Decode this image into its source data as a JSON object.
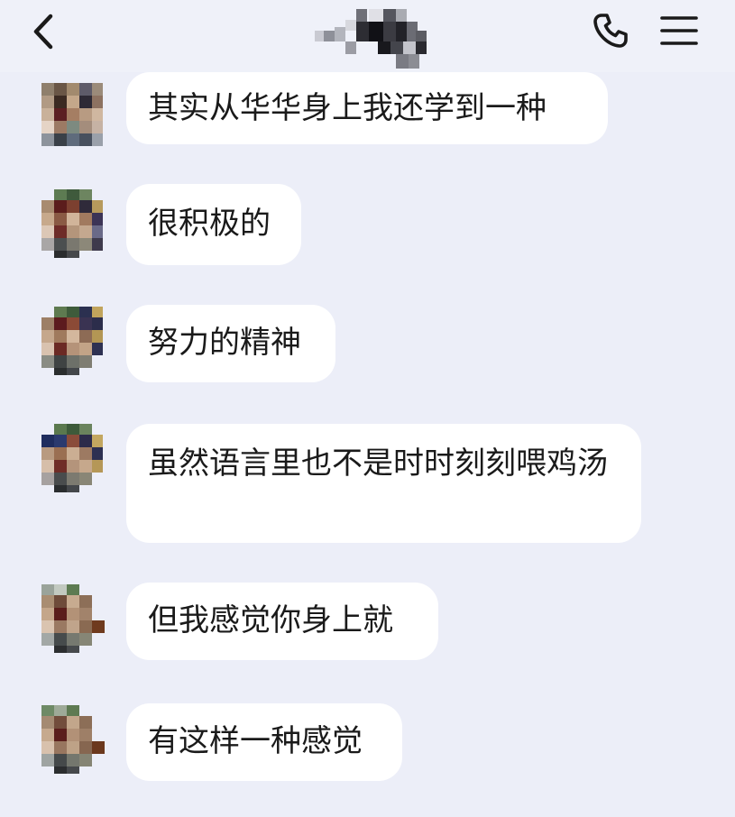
{
  "header": {
    "back_icon": "chevron-left-icon",
    "title_mosaic": "pixelated-contact-name",
    "phone_icon": "phone-icon",
    "menu_icon": "hamburger-menu-icon"
  },
  "colors": {
    "background": "#eceef8",
    "bubble": "#ffffff",
    "text": "#1a1a1a"
  },
  "messages": [
    {
      "text": "其实从华华身上我还学到一种"
    },
    {
      "text": "很积极的"
    },
    {
      "text": "努力的精神"
    },
    {
      "text": "虽然语言里也不是时时刻刻喂鸡汤"
    },
    {
      "text": "但我感觉你身上就"
    },
    {
      "text": "有这样一种感觉"
    }
  ]
}
